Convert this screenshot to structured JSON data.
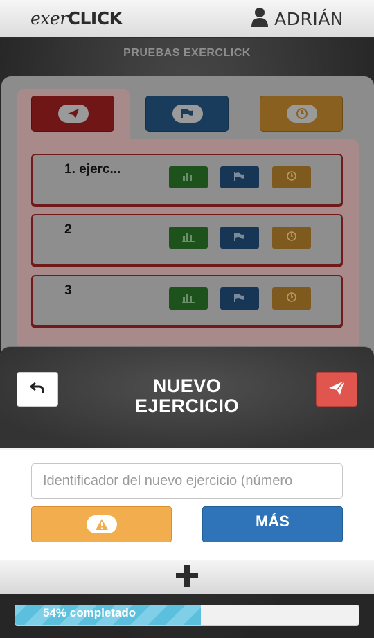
{
  "header": {
    "logo_pre": "exer",
    "logo_post": "CLICK",
    "user_name": "ADRIÁN",
    "user_icon": "user-icon"
  },
  "section_title": "PRUEBAS EXERCLICK",
  "tabs": [
    {
      "icon": "paper-plane-icon",
      "color": "#d9403a"
    },
    {
      "icon": "flag-icon",
      "color": "#2f74b8"
    },
    {
      "icon": "clock-icon",
      "color": "#f1ad4e"
    }
  ],
  "exercises": [
    {
      "label": "1. ejerc..."
    },
    {
      "label": "2"
    },
    {
      "label": "3"
    }
  ],
  "row_buttons": [
    {
      "icon": "bar-chart-icon",
      "color": "#3c9a3c"
    },
    {
      "icon": "flag-icon",
      "color": "#2f74b8"
    },
    {
      "icon": "clock-icon",
      "color": "#f1ad4e"
    }
  ],
  "modal": {
    "title_line1": "NUEVO",
    "title_line2": "EJERCICIO",
    "back_icon": "undo-arrow-icon",
    "send_icon": "paper-plane-icon",
    "input_placeholder": "Identificador del nuevo ejercicio (número",
    "warning_icon": "warning-icon",
    "more_label": "MÁS"
  },
  "add_icon": "plus-icon",
  "progress": {
    "percent": 54,
    "label": "54% completado"
  }
}
